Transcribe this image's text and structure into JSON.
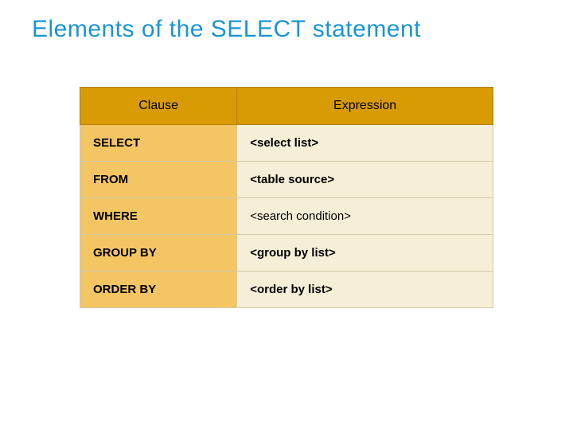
{
  "title": "Elements of the SELECT statement",
  "headers": {
    "clause": "Clause",
    "expression": "Expression"
  },
  "rows": [
    {
      "clause": "SELECT",
      "expression": "<select list>",
      "bold": true
    },
    {
      "clause": "FROM",
      "expression": "<table source>",
      "bold": true
    },
    {
      "clause": "WHERE",
      "expression": "<search condition>",
      "bold": false
    },
    {
      "clause": "GROUP BY",
      "expression": "<group by list>",
      "bold": true
    },
    {
      "clause": "ORDER BY",
      "expression": "<order by list>",
      "bold": true
    }
  ]
}
